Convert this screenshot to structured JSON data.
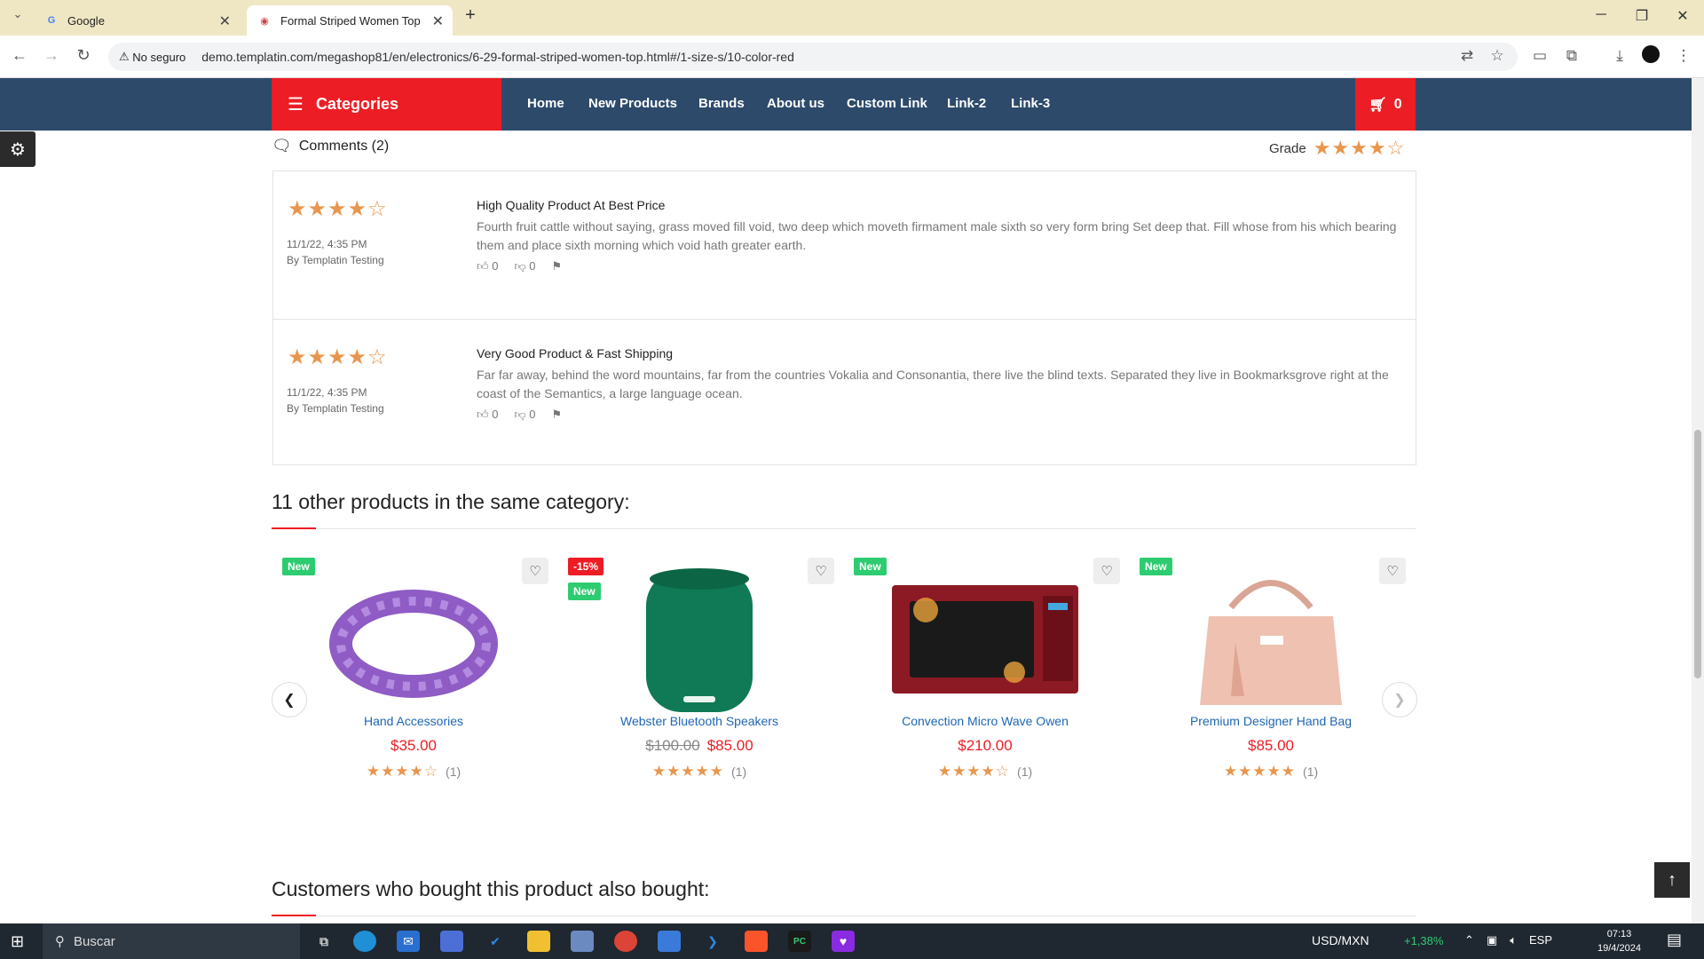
{
  "browser": {
    "tabs": [
      {
        "title": "Google",
        "favicon": "G"
      },
      {
        "title": "Formal Striped Women Top",
        "favicon": "◉"
      }
    ],
    "security_label": "No seguro",
    "url": "demo.templatin.com/megashop81/en/electronics/6-29-formal-striped-women-top.html#/1-size-s/10-color-red"
  },
  "nav": {
    "categories_label": "Categories",
    "links": [
      "Home",
      "New Products",
      "Brands",
      "About us",
      "Custom Link",
      "Link-2",
      "Link-3"
    ],
    "cart_count": "0"
  },
  "comments": {
    "title": "Comments (2)",
    "grade_label": "Grade",
    "grade_rating": 4,
    "items": [
      {
        "rating": 4,
        "date": "11/1/22, 4:35 PM",
        "author": "By Templatin Testing",
        "title": "High Quality Product At Best Price",
        "text": "Fourth fruit cattle without saying, grass moved fill void, two deep which moveth firmament male sixth so very form bring Set deep that. Fill whose from his which bearing them and place sixth morning which void hath greater earth.",
        "likes": "0",
        "dislikes": "0"
      },
      {
        "rating": 4,
        "date": "11/1/22, 4:35 PM",
        "author": "By Templatin Testing",
        "title": "Very Good Product & Fast Shipping",
        "text": "Far far away, behind the word mountains, far from the countries Vokalia and Consonantia, there live the blind texts. Separated they live in Bookmarksgrove right at the coast of the Semantics, a large language ocean.",
        "likes": "0",
        "dislikes": "0"
      }
    ]
  },
  "related": {
    "title": "11 other products in the same category:",
    "products": [
      {
        "name": "Hand Accessories",
        "price": "$35.00",
        "old_price": "",
        "badges": [
          "New"
        ],
        "rating": 4,
        "count": "(1)"
      },
      {
        "name": "Webster Bluetooth Speakers",
        "price": "$85.00",
        "old_price": "$100.00",
        "badges": [
          "-15%",
          "New"
        ],
        "rating": 5,
        "count": "(1)"
      },
      {
        "name": "Convection Micro Wave Owen",
        "price": "$210.00",
        "old_price": "",
        "badges": [
          "New"
        ],
        "rating": 4,
        "count": "(1)"
      },
      {
        "name": "Premium Designer Hand Bag",
        "price": "$85.00",
        "old_price": "",
        "badges": [
          "New"
        ],
        "rating": 5,
        "count": "(1)"
      }
    ]
  },
  "also_bought": {
    "title": "Customers who bought this product also bought:"
  },
  "taskbar": {
    "search_placeholder": "Buscar",
    "currency": "USD/MXN",
    "currency_change": "+1,38%",
    "language": "ESP",
    "time": "07:13",
    "date": "19/4/2024"
  },
  "colors": {
    "accent": "#ec1d25",
    "nav_bg": "#2d4a6b",
    "star": "#e8964e",
    "badge_new": "#2ecc71",
    "link": "#1f66b3"
  }
}
